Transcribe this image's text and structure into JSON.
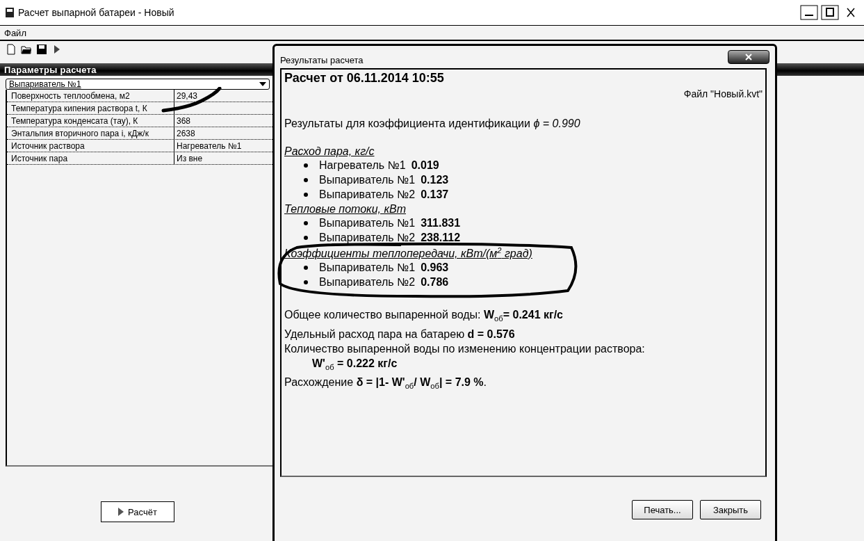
{
  "window": {
    "title": "Расчет выпарной батареи - Новый"
  },
  "menu": [
    "Файл"
  ],
  "panel": {
    "title": "Параметры расчета",
    "selector": "Выпариватель №1",
    "properties": [
      {
        "name": "Поверхность теплообмена, м2",
        "value": "29,43"
      },
      {
        "name": "Температура кипения раствора t, К"
      },
      {
        "name": "Температура конденсата (тау), К",
        "value": "368"
      },
      {
        "name": "Энтальпия вторичного пара i, кДж/к",
        "value": "2638"
      },
      {
        "name": "Источник раствора",
        "value": "Нагреватель №1"
      },
      {
        "name": "Источник пара",
        "value": "Из вне"
      }
    ],
    "run_button": "Расчёт"
  },
  "dialog": {
    "title": "Результаты расчета",
    "heading": "Расчет от 06.11.2014 10:55",
    "file": "Файл \"Новый.kvt\"",
    "intro": "Результаты для коэффициента идентификации *ϕ = 0.990*",
    "sections": [
      {
        "title": "Расход пара, кг/с",
        "items": [
          {
            "name": "Нагреватель №1",
            "value": "0.019"
          },
          {
            "name": "Выпариватель №1",
            "value": "0.123"
          },
          {
            "name": "Выпариватель №2",
            "value": "0.137"
          }
        ]
      },
      {
        "title": "Тепловые потоки, кВт",
        "items": [
          {
            "name": "Выпариватель №1",
            "value": "311.831"
          },
          {
            "name": "Выпариватель №2",
            "value": "238.112"
          }
        ]
      },
      {
        "title": "Коэффициенты теплопередачи, кВт/(м$^{2}$ град)",
        "circled": true,
        "items": [
          {
            "name": "Выпариватель №1",
            "value": "0.963"
          },
          {
            "name": "Выпариватель №2",
            "value": "0.786"
          }
        ]
      }
    ],
    "summary": [
      {
        "kind": "line",
        "text": "Общее количество выпаренной воды: **W**$_{об}$**= 0.241 кг/с**"
      },
      {
        "kind": "line",
        "text": "Удельный расход пара на батарею **d = 0.576**"
      },
      {
        "kind": "line",
        "text": "Количество выпаренной воды по изменению концентрации раствора:"
      },
      {
        "kind": "indent",
        "text": "**W'**$_{об}$ **= 0.222 кг/с**"
      },
      {
        "kind": "line",
        "text": "Расхождение **δ = |1- W'**$_{об}$**/ W**$_{об}$**| = 7.9 %**."
      }
    ],
    "buttons": [
      "Печать...",
      "Закрыть"
    ]
  }
}
